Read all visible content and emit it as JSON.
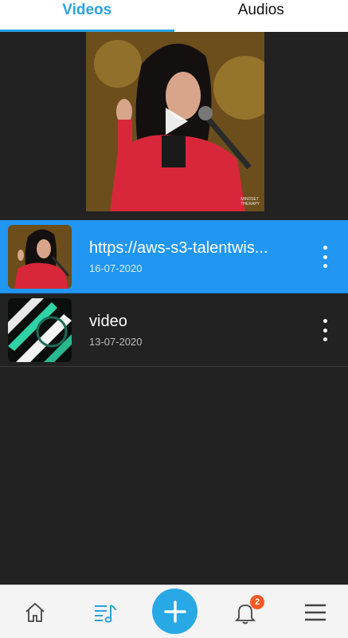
{
  "tabs": [
    {
      "label": "Videos",
      "active": true
    },
    {
      "label": "Audios",
      "active": false
    }
  ],
  "player": {
    "icon": "play-icon",
    "watermark_line1": "MINDSET",
    "watermark_line2": "THERAPY"
  },
  "items": [
    {
      "title": "https://aws-s3-talentwis...",
      "date": "16-07-2020",
      "selected": true
    },
    {
      "title": "video",
      "date": "13-07-2020",
      "selected": false
    }
  ],
  "bottom_nav": {
    "items": [
      "home-icon",
      "playlist-music-icon",
      "add-icon",
      "bell-icon",
      "menu-icon"
    ],
    "notification_count": "2"
  },
  "colors": {
    "accent": "#29a3e0",
    "selected_row": "#2196f3",
    "background": "#222222",
    "badge": "#ff5722"
  }
}
